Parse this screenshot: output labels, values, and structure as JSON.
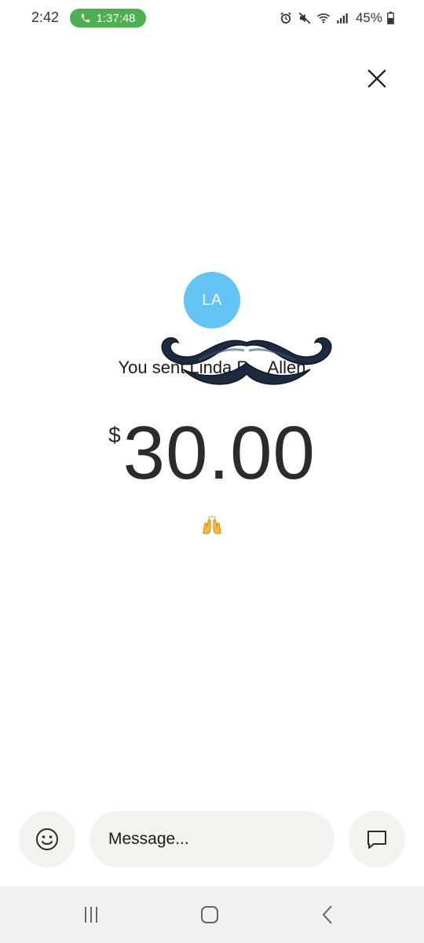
{
  "status_bar": {
    "time": "2:42",
    "call_duration": "1:37:48",
    "battery": "45%"
  },
  "recipient": {
    "initials": "LA"
  },
  "transaction": {
    "sent_text": "You sent Linda R... Allen",
    "currency_symbol": "$",
    "amount": "30.00",
    "emoji": "🙌"
  },
  "composer": {
    "placeholder": "Message..."
  },
  "icons": {
    "close": "close-icon",
    "emoji": "smiley-icon",
    "chat": "chat-bubble-icon",
    "call": "phone-icon",
    "alarm": "alarm-icon",
    "mute": "mute-icon",
    "wifi": "wifi-icon",
    "signal": "signal-icon",
    "battery": "battery-icon",
    "nav_recent": "recent-apps-icon",
    "nav_home": "home-icon",
    "nav_back": "back-icon"
  },
  "colors": {
    "call_pill": "#4caf50",
    "avatar": "#64c3f5",
    "composer_bg": "#f3f2ee",
    "mustache": "#1d2b40"
  }
}
